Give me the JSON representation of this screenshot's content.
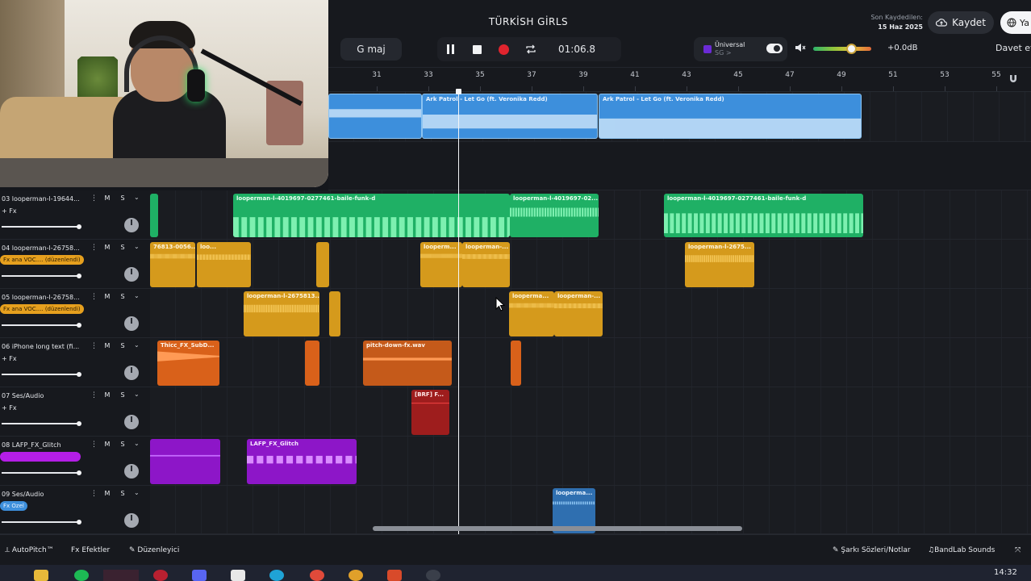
{
  "project": {
    "title": "TÜRKİSH GİRLS",
    "saved_label": "Son Kaydedilen:",
    "saved_date": "15 Haz 2025",
    "save_button": "Kaydet",
    "lang_button": "Ya",
    "invite_button": "Davet et"
  },
  "transport": {
    "key": "G maj",
    "time": "01:06.8",
    "record_color": "#e0242e"
  },
  "instrument": {
    "name": "Üniversal",
    "sub": "SG >"
  },
  "master": {
    "db": "+0.0dB",
    "volume_fraction": 0.7
  },
  "ruler": {
    "ticks": [
      "31",
      "33",
      "35",
      "37",
      "39",
      "41",
      "43",
      "45",
      "47",
      "49",
      "51",
      "53",
      "55"
    ]
  },
  "track1_clips": [
    {
      "name": ""
    },
    {
      "name": "Ark Patrol - Let Go (ft. Veronika Redd)"
    },
    {
      "name": "Ark Patrol - Let Go (ft. Veronika Redd)"
    }
  ],
  "tracks": [
    {
      "num": "03",
      "name": "looperman-l-19644...",
      "fx": "+ Fx",
      "clips": [
        "looperman-l-4019697-0277461-baile-funk-d",
        "looperman-l-4019697-02...",
        "looperman-l-4019697-0277461-baile-funk-d"
      ]
    },
    {
      "num": "04",
      "name": "looperman-l-26758...",
      "fx_tag": "Fx ana VOC.... (düzenlendi)",
      "clips": [
        "76813-0056...",
        "loo...",
        "looperm...",
        "looperman-...",
        "looperman-l-2675..."
      ]
    },
    {
      "num": "05",
      "name": "looperman-l-26758...",
      "fx_tag": "Fx ana VOC.... (düzenlendi)",
      "clips": [
        "looperman-l-2675813...",
        "looperma...",
        "looperman-..."
      ]
    },
    {
      "num": "06",
      "name": "iPhone long text (fi...",
      "fx": "+ Fx",
      "clips": [
        "Thicc_FX_SubD...",
        "pitch-down-fx.wav"
      ]
    },
    {
      "num": "07",
      "name": "Ses/Audio",
      "fx": "+ Fx",
      "clips": [
        "[BRF] F..."
      ]
    },
    {
      "num": "08",
      "name": "LAFP_FX_Glitch",
      "fx_tag": "",
      "clips": [
        "LAFP_FX_Glitch"
      ]
    },
    {
      "num": "09",
      "name": "Ses/Audio",
      "fx_tag": "Fx Ozel",
      "clips": [
        "looperma..."
      ]
    }
  ],
  "track_buttons": {
    "mute": "M",
    "solo": "S",
    "more": "⋮",
    "chevron": "⌄"
  },
  "bottom": {
    "autopitch": "AutoPitch™",
    "effects": "Efektler",
    "editor": "Düzenleyici",
    "lyrics": "Şarkı Sözleri/Notlar",
    "sounds": "BandLab Sounds",
    "fx_prefix": "Fx"
  },
  "taskbar": {
    "clock": "14:32"
  },
  "colors": {
    "blue": "#3d8fdc",
    "green": "#1fb065",
    "yellow": "#d59a1c",
    "orange": "#d9611a",
    "purple": "#8d16c8",
    "red": "#9e1d1d"
  }
}
